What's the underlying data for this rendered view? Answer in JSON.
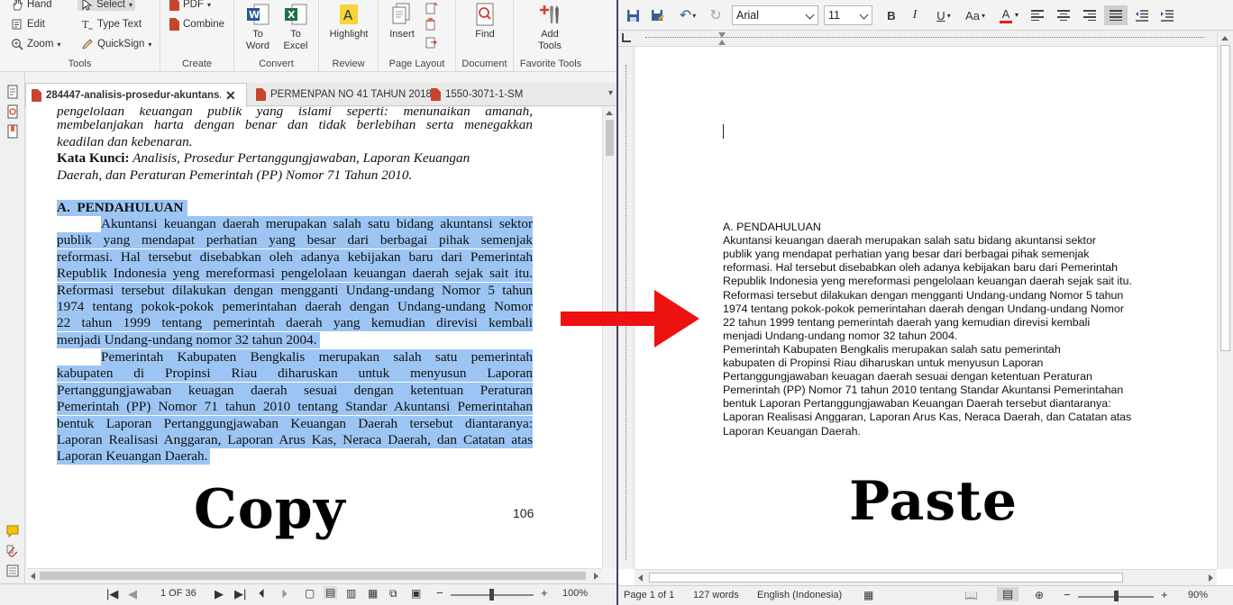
{
  "pdf_viewer": {
    "ribbon": {
      "tools_group": {
        "label": "Tools",
        "items": [
          "Hand",
          "Select",
          "Edit",
          "Type Text",
          "Zoom",
          "QuickSign"
        ]
      },
      "create_group": {
        "label": "Create",
        "items": [
          "PDF",
          "Combine"
        ]
      },
      "convert_group": {
        "label": "Convert",
        "to_word": "To Word",
        "to_excel": "To Excel"
      },
      "review_group": {
        "label": "Review",
        "highlight": "Highlight"
      },
      "page_layout_group": {
        "label": "Page Layout",
        "insert": "Insert"
      },
      "document_group": {
        "label": "Document",
        "find": "Find"
      },
      "favorite_tools_group": {
        "label": "Favorite Tools",
        "add_tools": "Add Tools"
      }
    },
    "tabs": [
      {
        "label": "284447-analisis-prosedur-akuntans...",
        "active": true
      },
      {
        "label": "PERMENPAN NO 41 TAHUN 2018",
        "active": false
      },
      {
        "label": "1550-3071-1-SM",
        "active": false
      }
    ],
    "page": {
      "lines_top": [
        "pengelolaan  keuangan  publik  yang  islami  seperti:  menunaikan  amanah,",
        "membelanjakan  harta  dengan  benar  dan  tidak  berlebihan  serta  menegakkan",
        "keadilan dan kebenaran."
      ],
      "keywords_label": "Kata Kunci:",
      "keywords_line1": " Analisis, Prosedur Pertanggungjawaban, Laporan Keuangan",
      "keywords_line2": "Daerah, dan Peraturan Pemerintah (PP) Nomor 71 Tahun 2010.",
      "section_letter": "A.",
      "section_title": "PENDAHULUAN",
      "para1": [
        "Akuntansi keuangan daerah merupakan salah satu bidang akuntansi sektor",
        "publik yang mendapat perhatian yang besar dari berbagai pihak semenjak",
        "reformasi.  Hal  tersebut disebabkan oleh adanya kebijakan baru dari Pemerintah",
        "Republik Indonesia yeng mereformasi pengelolaan keuangan daerah sejak sait itu.",
        "Reformasi tersebut dilakukan dengan mengganti Undang-undang Nomor 5 tahun",
        "1974  tentang pokok-pokok pemerintahan daerah dengan Undang-undang Nomor",
        "22 tahun  1999 tentang pemerintah daerah yang kemudian direvisi kembali",
        "menjadi Undang-undang nomor 32 tahun 2004."
      ],
      "para2": [
        "Pemerintah Kabupaten Bengkalis merupakan salah satu pemerintah",
        "kabupaten di Propinsi Riau diharuskan untuk menyusun Laporan",
        "Pertanggungjawaban keuagan daerah sesuai dengan ketentuan Peraturan",
        "Pemerintah (PP) Nomor 71 tahun 2010 tentang Standar Akuntansi Pemerintahan",
        "bentuk Laporan Pertanggungjawaban Keuangan Daerah tersebut diantaranya:",
        "Laporan Realisasi Anggaran, Laporan Arus Kas, Neraca Daerah, dan Catatan atas",
        "Laporan Keuangan Daerah."
      ],
      "page_number": "106",
      "overlay_word": "Copy"
    },
    "status": {
      "page_indicator": "1 OF 36",
      "zoom": "100%"
    }
  },
  "word_processor": {
    "toolbar": {
      "font_name": "Arial",
      "font_size": "11",
      "bold": "B",
      "italic": "I",
      "underline": "U",
      "font_size_toggle": "Aa",
      "font_color_letter": "A",
      "font_color": "#e81c1c"
    },
    "document": {
      "lines": [
        "A. PENDAHULUAN",
        "Akuntansi keuangan daerah merupakan salah satu bidang akuntansi sektor",
        "publik yang mendapat perhatian yang besar dari berbagai pihak semenjak",
        "reformasi.  Hal  tersebut disebabkan oleh adanya kebijakan baru dari Pemerintah",
        "Republik Indonesia yeng mereformasi pengelolaan keuangan daerah sejak sait itu.",
        "Reformasi tersebut dilakukan dengan mengganti Undang-undang Nomor 5 tahun",
        "1974  tentang pokok-pokok pemerintahan daerah dengan Undang-undang Nomor",
        "22 tahun  1999 tentang pemerintah daerah yang kemudian direvisi kembali",
        "menjadi Undang-undang nomor 32 tahun 2004.",
        "Pemerintah Kabupaten Bengkalis merupakan salah satu pemerintah",
        "kabupaten di Propinsi Riau diharuskan untuk menyusun Laporan",
        "Pertanggungjawaban keuagan daerah sesuai dengan ketentuan Peraturan",
        "Pemerintah (PP) Nomor 71 tahun 2010 tentang Standar Akuntansi Pemerintahan",
        "bentuk Laporan Pertanggungjawaban Keuangan Daerah tersebut diantaranya:",
        "Laporan Realisasi Anggaran, Laporan Arus Kas, Neraca Daerah, dan Catatan atas",
        "Laporan Keuangan Daerah."
      ],
      "overlay_word": "Paste"
    },
    "status": {
      "page": "Page 1 of 1",
      "words": "127 words",
      "language": "English (Indonesia)",
      "zoom": "90%"
    }
  },
  "colors": {
    "selection": "#9cc5f3",
    "arrow": "#ee1111",
    "divider": "#3c4a63"
  }
}
